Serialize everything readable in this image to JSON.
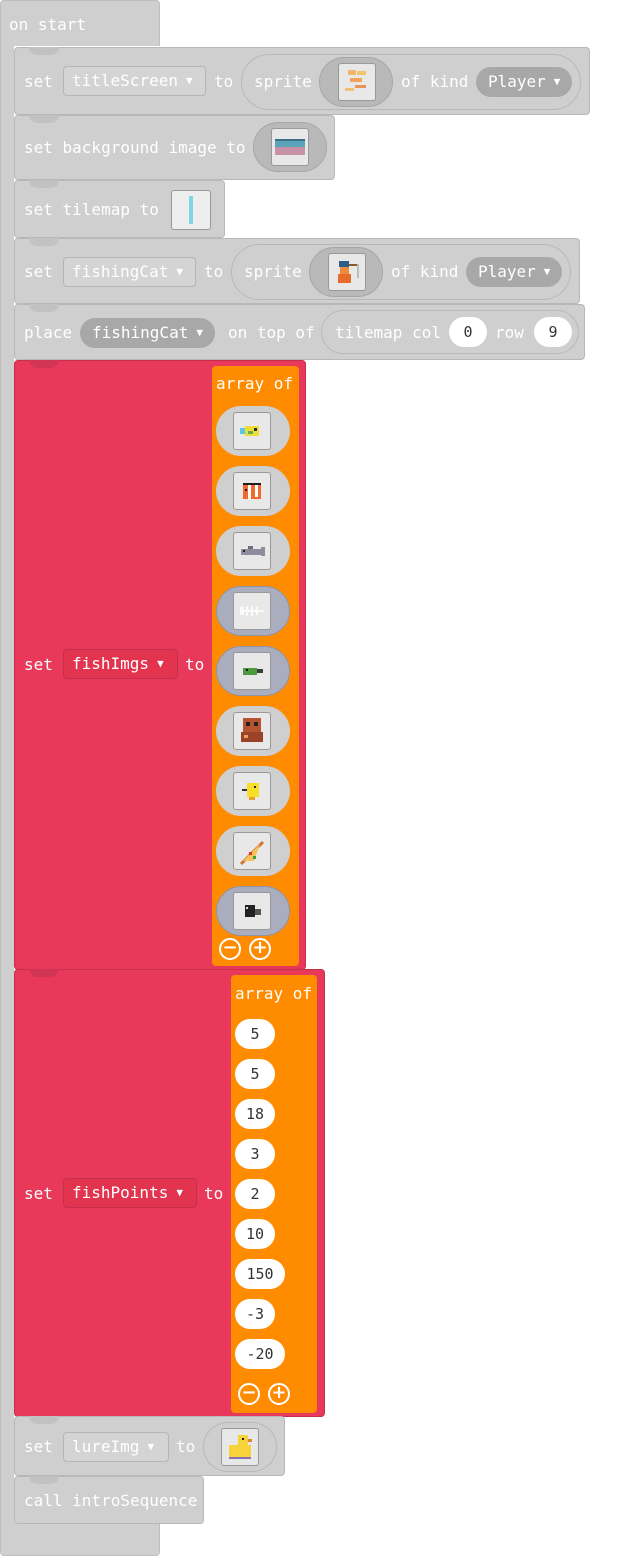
{
  "on_start": {
    "label": "on start"
  },
  "colors": {
    "loops": "#cfcfcf",
    "variables": "#e9395a",
    "arrays": "#ff8c00"
  },
  "blocks": {
    "titleScreen": {
      "set": "set",
      "var": "titleScreen",
      "to": "to",
      "sprite": "sprite",
      "of_kind": "of kind",
      "kind": "Player"
    },
    "background": {
      "label": "set background image to"
    },
    "tilemap": {
      "label": "set tilemap to"
    },
    "fishingCat": {
      "set": "set",
      "var": "fishingCat",
      "to": "to",
      "sprite": "sprite",
      "of_kind": "of kind",
      "kind": "Player"
    },
    "place": {
      "place": "place",
      "var": "fishingCat",
      "on_top_of": "on top of",
      "tilemap_col": "tilemap col",
      "col": "0",
      "row_label": "row",
      "row": "9"
    },
    "fishImgs": {
      "set": "set",
      "var": "fishImgs",
      "to": "to",
      "array_of": "array of",
      "images": [
        "yellow-fish",
        "clownfish",
        "gray-shark",
        "fish-bone",
        "green-fish",
        "octopus",
        "yellow-bird",
        "pizza-slice",
        "black-bird"
      ]
    },
    "fishPoints": {
      "set": "set",
      "var": "fishPoints",
      "to": "to",
      "array_of": "array of",
      "values": [
        "5",
        "5",
        "18",
        "3",
        "2",
        "10",
        "150",
        "-3",
        "-20"
      ]
    },
    "lureImg": {
      "set": "set",
      "var": "lureImg",
      "to": "to",
      "image": "rubber-duck"
    },
    "call": {
      "label": "call introSequence"
    }
  },
  "icons": {
    "dropdown": "chevron-down-icon",
    "remove": "minus-circle-icon",
    "add": "plus-circle-icon"
  }
}
